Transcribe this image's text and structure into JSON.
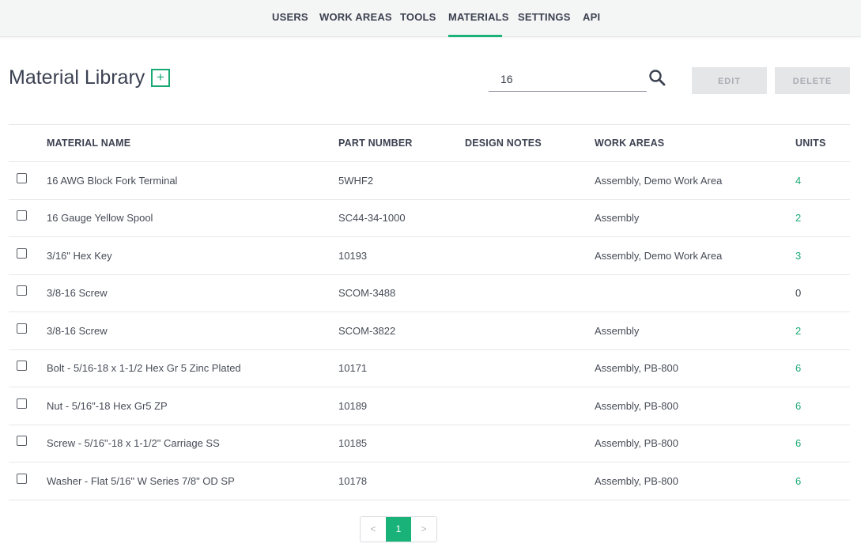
{
  "nav": {
    "tabs": [
      {
        "label": "USERS"
      },
      {
        "label": "WORK AREAS"
      },
      {
        "label": "TOOLS"
      },
      {
        "label": "MATERIALS"
      },
      {
        "label": "SETTINGS"
      },
      {
        "label": "API"
      }
    ],
    "active_tab": "MATERIALS"
  },
  "header": {
    "title": "Material Library",
    "add_label": "+"
  },
  "search": {
    "value": "16",
    "icon": "search-icon"
  },
  "actions": {
    "edit_label": "EDIT",
    "delete_label": "DELETE"
  },
  "table": {
    "columns": [
      "MATERIAL NAME",
      "PART NUMBER",
      "DESIGN NOTES",
      "WORK AREAS",
      "UNITS"
    ],
    "rows": [
      {
        "name": "16 AWG Block Fork Terminal",
        "part": "5WHF2",
        "notes": "",
        "areas": "Assembly, Demo Work Area",
        "units": "4"
      },
      {
        "name": "16 Gauge Yellow Spool",
        "part": "SC44-34-1000",
        "notes": "",
        "areas": "Assembly",
        "units": "2"
      },
      {
        "name": "3/16\" Hex Key",
        "part": "10193",
        "notes": "",
        "areas": "Assembly, Demo Work Area",
        "units": "3"
      },
      {
        "name": "3/8-16 Screw",
        "part": "SCOM-3488",
        "notes": "",
        "areas": "",
        "units": "0"
      },
      {
        "name": "3/8-16 Screw",
        "part": "SCOM-3822",
        "notes": "",
        "areas": "Assembly",
        "units": "2"
      },
      {
        "name": "Bolt - 5/16-18 x 1-1/2 Hex Gr 5 Zinc Plated",
        "part": "10171",
        "notes": "",
        "areas": "Assembly, PB-800",
        "units": "6"
      },
      {
        "name": "Nut - 5/16\"-18 Hex Gr5 ZP",
        "part": "10189",
        "notes": "",
        "areas": "Assembly, PB-800",
        "units": "6"
      },
      {
        "name": "Screw - 5/16\"-18 x 1-1/2\" Carriage SS",
        "part": "10185",
        "notes": "",
        "areas": "Assembly, PB-800",
        "units": "6"
      },
      {
        "name": "Washer - Flat 5/16\" W Series 7/8\" OD SP",
        "part": "10178",
        "notes": "",
        "areas": "Assembly, PB-800",
        "units": "6"
      }
    ]
  },
  "pagination": {
    "prev": "<",
    "current": "1",
    "next": ">"
  },
  "colors": {
    "accent": "#19b37a",
    "units_link": "#19a974",
    "disabled_button_bg": "#e4e6e8"
  }
}
